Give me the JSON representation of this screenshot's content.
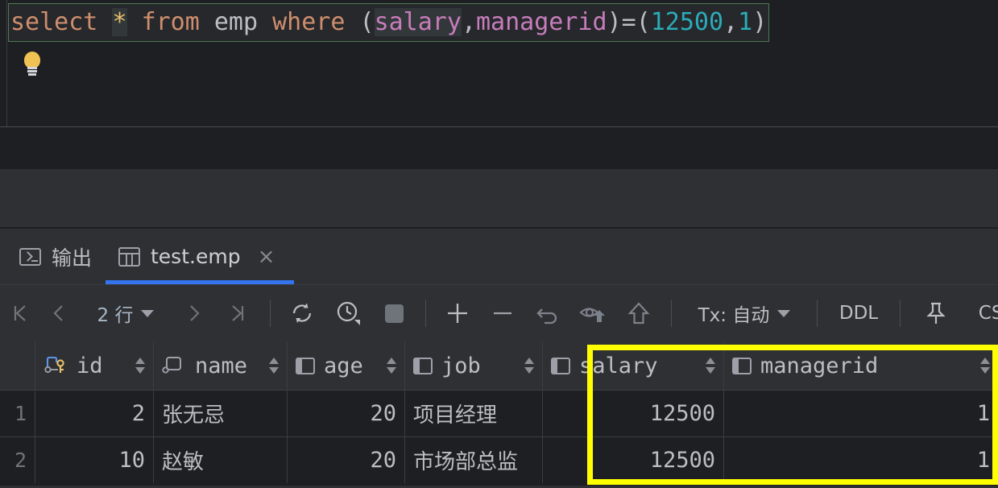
{
  "editor": {
    "sql_tokens": [
      {
        "t": "select",
        "c": "kw"
      },
      {
        "t": " ",
        "c": "punc"
      },
      {
        "t": "*",
        "c": "star",
        "hl": true
      },
      {
        "t": " ",
        "c": "punc"
      },
      {
        "t": "from",
        "c": "kw"
      },
      {
        "t": " ",
        "c": "punc"
      },
      {
        "t": "emp",
        "c": "ident"
      },
      {
        "t": " ",
        "c": "punc"
      },
      {
        "t": "where",
        "c": "kw"
      },
      {
        "t": " ",
        "c": "punc"
      },
      {
        "t": "(",
        "c": "paren"
      },
      {
        "t": "salary",
        "c": "col",
        "hl": true
      },
      {
        "t": ",",
        "c": "punc"
      },
      {
        "t": "managerid",
        "c": "col"
      },
      {
        "t": ")",
        "c": "paren"
      },
      {
        "t": "=",
        "c": "punc"
      },
      {
        "t": "(",
        "c": "paren"
      },
      {
        "t": "12500",
        "c": "num"
      },
      {
        "t": ",",
        "c": "punc"
      },
      {
        "t": "1",
        "c": "num"
      },
      {
        "t": ")",
        "c": "paren"
      }
    ],
    "sql_plain": "select * from emp where (salary,managerid)=(12500,1)",
    "hint_icon": "lightbulb-icon"
  },
  "tabs": [
    {
      "id": "output",
      "label": "输出",
      "icon": "console-icon",
      "active": false,
      "closable": false
    },
    {
      "id": "result",
      "label": "test.emp",
      "icon": "table-grid-icon",
      "active": true,
      "closable": true,
      "close_label": "×"
    }
  ],
  "toolbar": {
    "first_page_icon": "first-page-icon",
    "prev_page_icon": "previous-page-icon",
    "row_count_label": "2 行",
    "row_count_caret": "chevron-down-icon",
    "next_page_icon": "next-page-icon",
    "last_page_icon": "last-page-icon",
    "refresh_icon": "refresh-icon",
    "history_icon": "history-clock-icon",
    "stop_icon": "stop-icon",
    "add_row_icon": "plus-icon",
    "delete_row_icon": "minus-icon",
    "revert_icon": "revert-undo-icon",
    "preview_submit_icon": "eye-submit-icon",
    "submit_icon": "upload-arrow-icon",
    "tx_label": "Tx: 自动",
    "tx_caret": "chevron-down-icon",
    "ddl_label": "DDL",
    "pin_icon": "pin-icon",
    "csv_label": "CSV",
    "csv_caret": "chevron-down-icon",
    "export_icon": "download-icon"
  },
  "grid": {
    "row_number_header": "",
    "columns": [
      {
        "name": "id",
        "icon": "primary-key-column-icon",
        "align": "right"
      },
      {
        "name": "name",
        "icon": "indexed-column-icon",
        "align": "left"
      },
      {
        "name": "age",
        "icon": "column-icon",
        "align": "right"
      },
      {
        "name": "job",
        "icon": "column-icon",
        "align": "left"
      },
      {
        "name": "salary",
        "icon": "column-icon",
        "align": "right"
      },
      {
        "name": "managerid",
        "icon": "column-icon",
        "align": "right"
      }
    ],
    "rows": [
      {
        "n": "1",
        "id": "2",
        "name": "张无忌",
        "age": "20",
        "job": "项目经理",
        "salary": "12500",
        "managerid": "1"
      },
      {
        "n": "2",
        "id": "10",
        "name": "赵敏",
        "age": "20",
        "job": "市场部总监",
        "salary": "12500",
        "managerid": "1"
      }
    ]
  },
  "annotation": {
    "highlight_color": "#ffff00",
    "highlight_target": "salary and managerid columns"
  },
  "colors": {
    "editor_bg": "#1e1f22",
    "panel_bg": "#2e3034",
    "accent": "#3574f0",
    "keyword": "#cf8e6d",
    "column": "#c77dbb",
    "number": "#2aacb8",
    "text": "#bcbec4"
  }
}
